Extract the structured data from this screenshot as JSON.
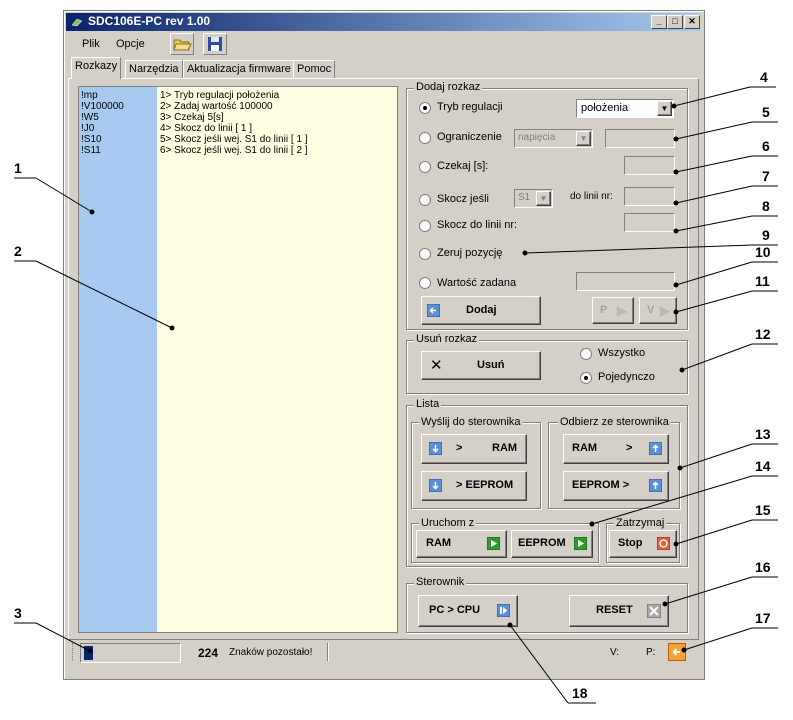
{
  "window": {
    "title": "SDC106E-PC rev 1.00"
  },
  "menu": {
    "file": "Plik",
    "options": "Opcje"
  },
  "tabs": [
    "Rozkazy",
    "Narzędzia",
    "Aktualizacja firmware",
    "Pomoc"
  ],
  "program": {
    "codes": [
      "!mp",
      "!V100000",
      "!W5",
      "!J0",
      "!S10",
      "!S11"
    ],
    "lines": [
      "1> Tryb regulacji położenia",
      "2> Zadaj wartość 100000",
      "3> Czekaj 5[s]",
      "4> Skocz do linii [ 1 ]",
      "5> Skocz jeśli wej. S1 do linii [ 1 ]",
      "6> Skocz jeśli wej. S1 do linii [ 2 ]"
    ]
  },
  "add_command": {
    "title": "Dodaj rozkaz",
    "mode_label": "Tryb regulacji",
    "mode_value": "położenia",
    "limit_label": "Ograniczenie",
    "limit_value": "napięcia",
    "wait_label": "Czekaj  [s]:",
    "jump_if_label": "Skocz jeśli",
    "jump_if_value": "S1",
    "to_line_label": "do linii nr:",
    "jump_label": "Skocz do linii nr:",
    "reset_pos_label": "Zeruj pozycję",
    "setpoint_label": "Wartość zadana",
    "add_button": "Dodaj",
    "p_button": "P",
    "v_button": "V"
  },
  "remove_command": {
    "title": "Usuń rozkaz",
    "remove_button": "Usuń",
    "all_label": "Wszystko",
    "single_label": "Pojedynczo"
  },
  "list": {
    "title": "Lista",
    "send_title": "Wyślij do sterownika",
    "receive_title": "Odbierz ze sterownika",
    "send_ram": "RAM",
    "send_eeprom": "> EEPROM",
    "send_arrow": ">",
    "recv_ram": "RAM",
    "recv_arrow": ">",
    "recv_eeprom": "EEPROM >",
    "run_title": "Uruchom z",
    "run_ram": "RAM",
    "run_eeprom": "EEPROM",
    "stop_title": "Zatrzymaj",
    "stop_button": "Stop"
  },
  "controller": {
    "title": "Sterownik",
    "pc_cpu": "PC > CPU",
    "reset": "RESET"
  },
  "status": {
    "count": "224",
    "remaining": "Znaków pozostało!",
    "v_label": "V:",
    "p_label": "P:"
  },
  "callouts": [
    "1",
    "2",
    "3",
    "4",
    "5",
    "6",
    "7",
    "8",
    "9",
    "10",
    "11",
    "12",
    "13",
    "14",
    "15",
    "16",
    "17",
    "18"
  ],
  "colors": {
    "title_bar": "#0a246a",
    "code_column": "#a6caf0",
    "listing_bg": "#ffffe1",
    "play_green": "#2e9b2e",
    "stop_red": "#d03020"
  }
}
